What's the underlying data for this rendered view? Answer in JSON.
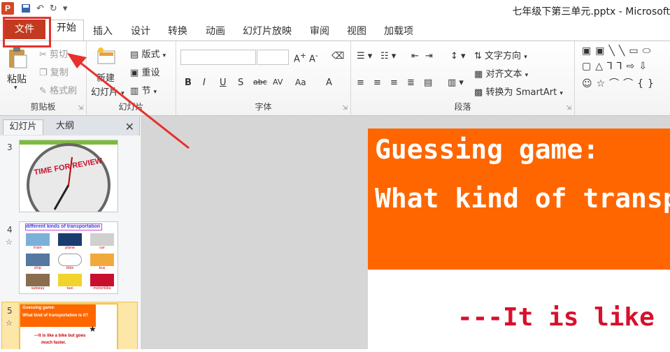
{
  "titlebar": {
    "app_icon": "P",
    "qat_icons": [
      "save-icon",
      "undo-icon",
      "redo-icon",
      "customize-icon"
    ],
    "document_title": "七年级下第三单元.pptx - Microsoft"
  },
  "tabs": [
    "文件",
    "开始",
    "插入",
    "设计",
    "转换",
    "动画",
    "幻灯片放映",
    "审阅",
    "视图",
    "加载项"
  ],
  "ribbon": {
    "clipboard": {
      "paste": "粘贴",
      "cut": "剪切",
      "copy": "复制",
      "format_painter": "格式刷",
      "label": "剪贴板"
    },
    "slides": {
      "new_slide": "新建",
      "new_slide_line2": "幻灯片",
      "layout": "版式",
      "reset": "重设",
      "section": "节",
      "label": "幻灯片"
    },
    "font": {
      "label": "字体",
      "bold": "B",
      "italic": "I",
      "underline": "U",
      "shadow": "S",
      "strike": "abc",
      "spacing": "AV",
      "case": "Aa",
      "color": "A"
    },
    "paragraph": {
      "text_direction": "文字方向",
      "align_text": "对齐文本",
      "smartart": "转换为 SmartArt",
      "label": "段落"
    }
  },
  "left_pane": {
    "tab_slides": "幻灯片",
    "tab_outline": "大纲",
    "close": "✕",
    "slides": [
      {
        "number": "3",
        "caption": "TIME FOR REVIEW"
      },
      {
        "number": "4",
        "caption": "different kinds of transportation",
        "items": [
          "train",
          "plane",
          "car",
          "ship",
          "bike",
          "bus",
          "subway",
          "taxi",
          "motorbike"
        ]
      },
      {
        "number": "5",
        "line1": "Guessing game:",
        "line2": "What kind of transportation is it?",
        "line3": "---It is like a bike but goes",
        "line4": "much faster."
      }
    ]
  },
  "slide": {
    "title_line1": "Guessing  game:",
    "title_line2": "What kind of transpo",
    "body": "---It is like a b"
  },
  "colors": {
    "file_tab": "#c33a20",
    "highlight": "#e8302c",
    "slide_header": "#ff6600",
    "slide_body_text": "#d8102c"
  }
}
